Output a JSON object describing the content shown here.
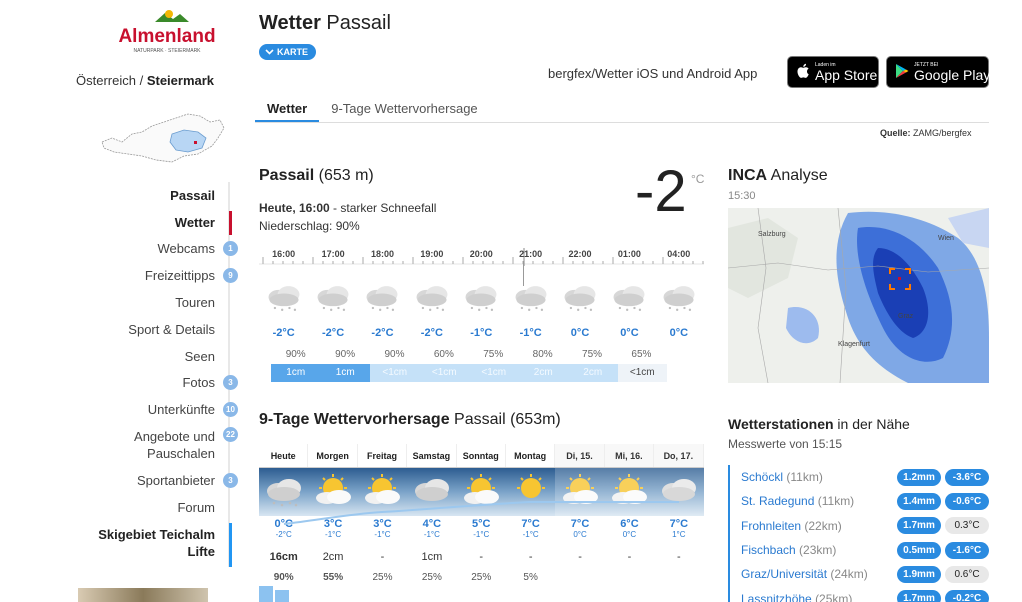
{
  "sidebar": {
    "logo_text": "Almenland",
    "logo_sub": "NATURPARK · STEIERMARK",
    "region_country": "Österreich",
    "region_sep": " / ",
    "region_state": "Steiermark",
    "items": [
      {
        "label": "Passail",
        "bold": true,
        "badge": ""
      },
      {
        "label": "Wetter",
        "bold": true,
        "badge": "",
        "active": true
      },
      {
        "label": "Webcams",
        "badge": "1"
      },
      {
        "label": "Freizeittipps",
        "badge": "9"
      },
      {
        "label": "Touren",
        "badge": ""
      },
      {
        "label": "Sport & Details",
        "badge": ""
      },
      {
        "label": "Seen",
        "badge": ""
      },
      {
        "label": "Fotos",
        "badge": "3"
      },
      {
        "label": "Unterkünfte",
        "badge": "10"
      },
      {
        "label_line1": "Angebote und",
        "label_line2": "Pauschalen",
        "badge": "22"
      },
      {
        "label": "Sportanbieter",
        "badge": "3"
      },
      {
        "label": "Forum",
        "badge": ""
      },
      {
        "label_line1": "Skigebiet Teichalm",
        "label_line2": "Lifte",
        "bold": true,
        "badge": ""
      }
    ]
  },
  "header": {
    "title_bold": "Wetter",
    "title_rest": " Passail",
    "karte_label": "KARTE",
    "app_text": "bergfex/Wetter iOS und Android App",
    "appstore_small": "Laden im",
    "appstore_big": "App Store",
    "googleplay_small": "JETZT BEI",
    "googleplay_big": "Google Play",
    "tabs": [
      "Wetter",
      "9-Tage Wettervorhersage"
    ],
    "quelle_label": "Quelle:",
    "quelle_value": " ZAMG/bergfex"
  },
  "current": {
    "location": "Passail",
    "altitude": "(653 m)",
    "temp": "-2",
    "unit": "°C",
    "today_bold": "Heute, 16:00",
    "today_desc": " - starker Schneefall",
    "niederschlag": "Niederschlag: 90%",
    "hours": [
      "16:00",
      "17:00",
      "18:00",
      "19:00",
      "20:00",
      "21:00",
      "22:00",
      "01:00",
      "04:00"
    ],
    "temps": [
      "-2°C",
      "-2°C",
      "-2°C",
      "-2°C",
      "-1°C",
      "-1°C",
      "0°C",
      "0°C",
      "0°C"
    ],
    "pcts": [
      "90%",
      "90%",
      "90%",
      "60%",
      "75%",
      "80%",
      "75%",
      "65%"
    ],
    "snow": [
      "1cm",
      "1cm",
      "<1cm",
      "<1cm",
      "<1cm",
      "2cm",
      "2cm",
      "<1cm"
    ]
  },
  "forecast": {
    "title_bold": "9-Tage Wettervorhersage",
    "title_rest": " Passail (653m)",
    "days": [
      "Heute",
      "Morgen",
      "Freitag",
      "Samstag",
      "Sonntag",
      "Montag",
      "Di, 15.",
      "Mi, 16.",
      "Do, 17."
    ],
    "max": [
      "0°C",
      "3°C",
      "3°C",
      "4°C",
      "5°C",
      "7°C",
      "7°C",
      "6°C",
      "7°C"
    ],
    "min": [
      "-2°C",
      "-1°C",
      "-1°C",
      "-1°C",
      "-1°C",
      "-1°C",
      "0°C",
      "0°C",
      "1°C"
    ],
    "snow": [
      "16cm",
      "2cm",
      "-",
      "1cm",
      "-",
      "-",
      "-",
      "-",
      "-"
    ],
    "pcts": [
      "90%",
      "55%",
      "25%",
      "25%",
      "25%",
      "5%",
      "",
      "",
      ""
    ]
  },
  "inca": {
    "title_bold": "INCA",
    "title_rest": " Analyse",
    "time": "15:30"
  },
  "stations": {
    "title_bold": "Wetterstationen",
    "title_rest": " in der Nähe",
    "subtitle": "Messwerte von 15:15",
    "rows": [
      {
        "name": "Schöckl",
        "dist": "(11km)",
        "mm": "1.2mm",
        "temp": "-3.6°C",
        "light": false
      },
      {
        "name": "St. Radegund",
        "dist": "(11km)",
        "mm": "1.4mm",
        "temp": "-0.6°C",
        "light": false
      },
      {
        "name": "Frohnleiten",
        "dist": "(22km)",
        "mm": "1.7mm",
        "temp": "0.3°C",
        "light": true
      },
      {
        "name": "Fischbach",
        "dist": "(23km)",
        "mm": "0.5mm",
        "temp": "-1.6°C",
        "light": false
      },
      {
        "name": "Graz/Universität",
        "dist": "(24km)",
        "mm": "1.9mm",
        "temp": "0.6°C",
        "light": true
      },
      {
        "name": "Lassnitzhöhe",
        "dist": "(25km)",
        "mm": "1.7mm",
        "temp": "-0.2°C",
        "light": false
      }
    ]
  }
}
